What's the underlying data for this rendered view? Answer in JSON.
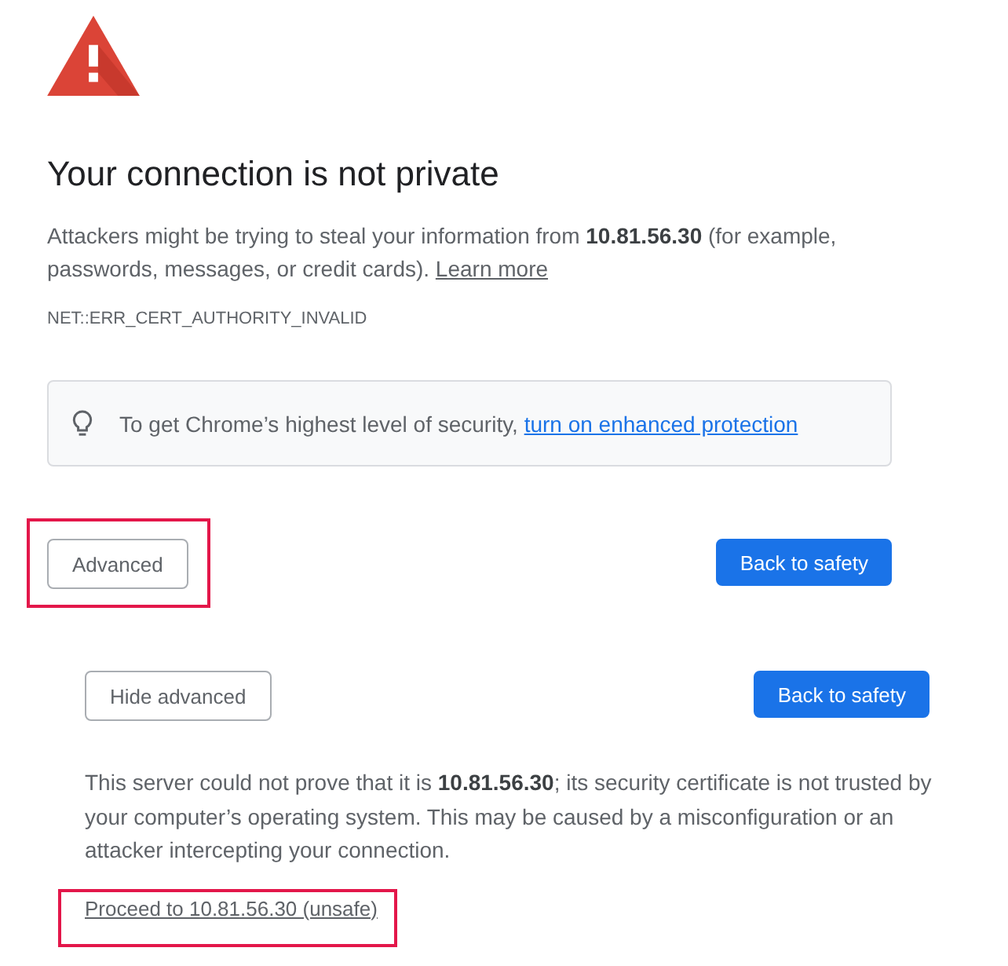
{
  "heading": "Your connection is not private",
  "explanation": {
    "text": "Attackers might be trying to steal your information from **10.81.56.30** (for example, passwords, messages, or credit cards).",
    "link": "Learn more"
  },
  "error_code": "NET::ERR_CERT_AUTHORITY_INVALID",
  "enhanced_protection": {
    "text": "To get Chrome’s highest level of security,",
    "link": "turn on enhanced protection"
  },
  "actions": [
    {
      "kind": "secondary",
      "label": "Advanced",
      "highlighted": true
    },
    {
      "kind": "primary",
      "label": "Back to safety",
      "highlighted": false
    }
  ],
  "details": {
    "actions": [
      {
        "kind": "secondary",
        "label": "Hide advanced"
      },
      {
        "kind": "primary",
        "label": "Back to safety"
      }
    ],
    "text": "This server could not prove that it is **10.81.56.30**; its security certificate is not trusted by your computer’s operating system. This may be caused by a misconfiguration or an attacker intercepting your connection.",
    "proceed_link": {
      "label": "Proceed to 10.81.56.30 (unsafe)",
      "highlighted": true
    }
  }
}
